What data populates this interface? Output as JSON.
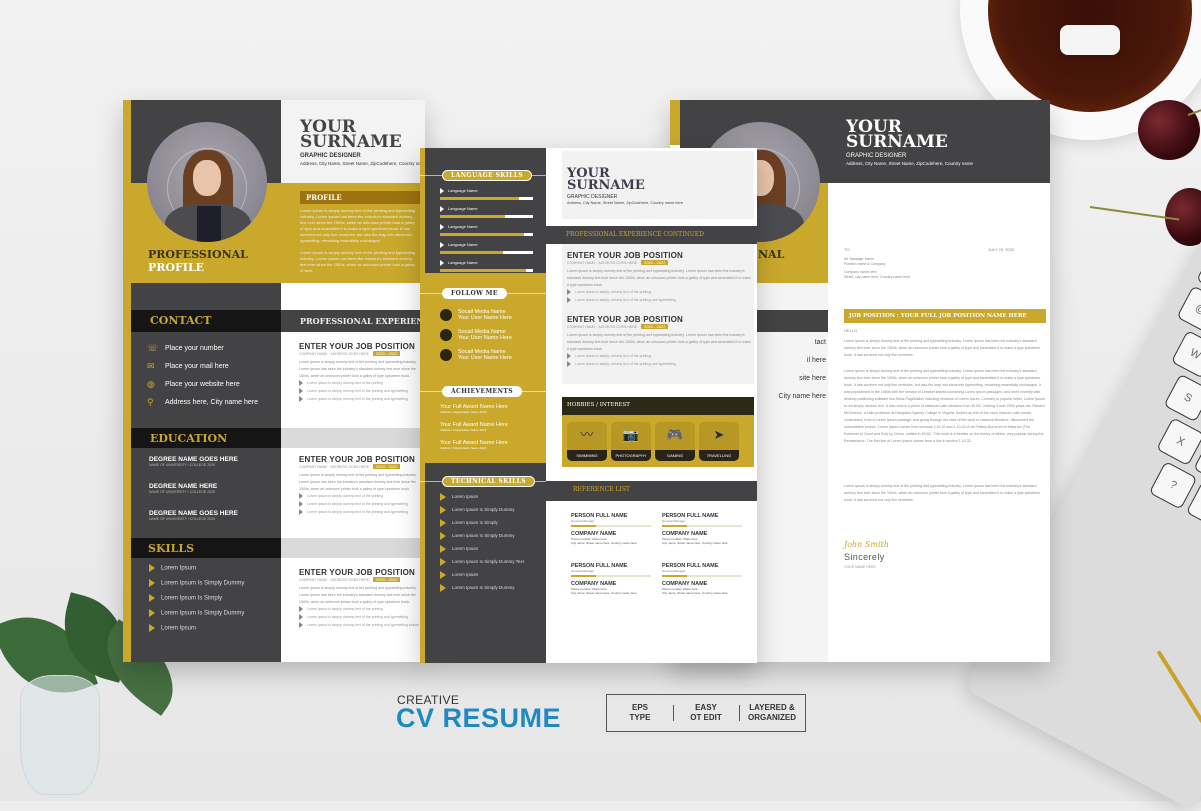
{
  "colors": {
    "gold": "#c9a82c",
    "dark": "#434345",
    "darker": "#151515",
    "accent_blue": "#1f8ac0"
  },
  "resume_front": {
    "name_line1": "YOUR",
    "name_line2": "SURNAME",
    "role": "GRAPHIC DESIGNER",
    "address": "Address, City Name, Street Name, ZipCodehere, Country name",
    "profile_title": "PROFILE",
    "profile_para1": "Lorem Ipsum is simply dummy text of the printing and typesetting industry. Lorem Ipsum has been the industry's standard dummy text ever since the 1500s, when an unknown printer took a galley of type and scrambled it to make a type specimen book. It has survived not only five centuries, but also the leap into electronic typesetting, remaining essentially unchanged.",
    "profile_para2": "Lorem Ipsum is simply dummy text of the printing and typesetting industry. Lorem Ipsum has been the industry's standard dummy text ever since the 1500s, when an unknown printer took a galley of type.",
    "professional_label1": "PROFESSIONAL",
    "professional_label2": "PROFILE",
    "contact_title": "CONTACT",
    "contact_items": [
      {
        "icon": "phone-icon",
        "text": "Place your number"
      },
      {
        "icon": "mail-icon",
        "text": "Place your mail here"
      },
      {
        "icon": "globe-icon",
        "text": "Place your website here"
      },
      {
        "icon": "location-icon",
        "text": "Address here, City name here"
      }
    ],
    "education_title": "EDUCATION",
    "education_items": [
      {
        "degree": "DEGREE NAME GOES HERE",
        "school": "NAME OF UNIVERSITY / COLLEGE  2020"
      },
      {
        "degree": "DEGREE NAME HERE",
        "school": "NAME OF UNIVERSITY / COLLEGE  2020"
      },
      {
        "degree": "DEGREE NAME GOES HERE",
        "school": "NAME OF UNIVERSITY / COLLEGE  2020"
      }
    ],
    "skills_title": "SKILLS",
    "skills": [
      "Lorem Ipsum",
      "Lorem Ipsum Is Simply Dummy",
      "Lorem Ipsum Is Simply",
      "Lorem Ipsum Is Simply Dummy",
      "Lorem Ipsum"
    ],
    "experience_title": "PROFESSIONAL EXPERIENCE",
    "jobs": [
      {
        "title": "ENTER YOUR JOB POSITION",
        "company": "COMPANY NAME · ADDRESS GOES HERE",
        "date": "2020 - 2022",
        "desc": "Lorem Ipsum is simply dummy text of the printing and typesetting industry. Lorem Ipsum has been the industry's standard dummy text ever since the 1500s, when an unknown printer took a galley of type specimen book.",
        "bullets": [
          "Lorem Ipsum is simply dummy text of the printing",
          "Lorem Ipsum is simply dummy text of the printing and typesetting",
          "Lorem Ipsum is simply dummy text of the printing and typesetting"
        ]
      },
      {
        "title": "ENTER YOUR JOB POSITION",
        "company": "COMPANY NAME · ADDRESS GOES HERE",
        "date": "2020 - 2022",
        "desc": "Lorem Ipsum is simply dummy text of the printing and typesetting industry. Lorem Ipsum has been the industry's standard dummy text ever since the 1500s, when an unknown printer took a galley of type specimen book.",
        "bullets": [
          "Lorem Ipsum is simply dummy text of the printing",
          "Lorem Ipsum is simply dummy text of the printing and typesetting",
          "Lorem Ipsum is simply dummy text of the printing and typesetting"
        ]
      },
      {
        "title": "ENTER YOUR JOB POSITION",
        "company": "COMPANY NAME · ADDRESS GOES HERE",
        "date": "2020 - 2022",
        "desc": "Lorem Ipsum is simply dummy text of the printing and typesetting industry. Lorem Ipsum has been the industry's standard dummy text ever since the 1500s, when an unknown printer took a galley of type specimen book.",
        "bullets": [
          "Lorem Ipsum is simply dummy text of the printing",
          "Lorem Ipsum is simply dummy text of the printing and typesetting",
          "Lorem Ipsum is simply dummy text of the printing and typesetting industry"
        ]
      }
    ]
  },
  "resume_back": {
    "language_title": "LANGUAGE SKILLS",
    "languages": [
      {
        "name": "Language Name",
        "level": 0.85
      },
      {
        "name": "Language Name",
        "level": 0.7
      },
      {
        "name": "Language Name",
        "level": 0.9
      },
      {
        "name": "Language Name",
        "level": 0.68
      },
      {
        "name": "Language Name",
        "level": 0.92
      }
    ],
    "follow_title": "FOLLOW ME",
    "social": [
      {
        "name": "Socail Media Name",
        "user": "Your User Name Here"
      },
      {
        "name": "Socail Media Name",
        "user": "Your User Name Here"
      },
      {
        "name": "Socail Media Name",
        "user": "Your User Name Here"
      }
    ],
    "achievements_title": "ACHIEVEMENTS",
    "achievements": [
      {
        "award": "Your Full Award Name Here",
        "detail": "Institute / Organization Name  2020"
      },
      {
        "award": "Your Full Award Name Here",
        "detail": "Institute / Organization Name  2020"
      },
      {
        "award": "Your Full Award Name Here",
        "detail": "Institute / Organization Name  2020"
      }
    ],
    "technical_title": "TECHNICAL SKILLS",
    "technical": [
      "Lorem Ipsum",
      "Lorem Ipsum Is Simply Dummy",
      "Lorem Ipsum Is Simply",
      "Lorem Ipsum Is Simply Dummy",
      "Lorem Ipsum",
      "Lorem Ipsum Is Simply Dummy Text",
      "Lorem Ipsum",
      "Lorem Ipsum Is Simply Dummy"
    ],
    "name_line1": "YOUR",
    "name_line2": "SURNAME",
    "role": "GRAPHIC DESIGNER",
    "address": "Address, City Name, Street Name, ZipCodehere, Country name here",
    "experience_cont_title": "PROFESSIONAL EXPERIENCE CONTINUED",
    "jobs": [
      {
        "title": "ENTER YOUR JOB POSITION",
        "company": "COMPANY NAME · ADDRESS GOES HERE",
        "date": "2020 - 2022",
        "desc": "Lorem Ipsum is simply dummy text of the printing and typesetting industry. Lorem Ipsum has been the industry's standard dummy text ever since the 1500s, when an unknown printer took a galley of type and scrambled it to make a type specimen book.",
        "bullets": [
          "Lorem Ipsum is simply dummy text of the printing",
          "Lorem Ipsum is simply dummy text of the printing and typesetting"
        ]
      },
      {
        "title": "ENTER YOUR JOB POSITION",
        "company": "COMPANY NAME · ADDRESS GOES HERE",
        "date": "2020 - 2022",
        "desc": "Lorem Ipsum is simply dummy text of the printing and typesetting industry. Lorem Ipsum has been the industry's standard dummy text ever since the 1500s, when an unknown printer took a galley of type and scrambled it to make a type specimen book.",
        "bullets": [
          "Lorem Ipsum is simply dummy text of the printing",
          "Lorem Ipsum is simply dummy text of the printing and typesetting"
        ]
      }
    ],
    "hobbies_title": "HOBBIES / INTEREST",
    "hobbies": [
      {
        "icon": "swimming-icon",
        "label": "SWIMMING"
      },
      {
        "icon": "camera-icon",
        "label": "PHOTOGRAPHY"
      },
      {
        "icon": "gamepad-icon",
        "label": "GAMING"
      },
      {
        "icon": "plane-icon",
        "label": "TRAVELLING"
      }
    ],
    "reference_title": "REFERENCE LIST",
    "references": [
      {
        "person": "PERSON FULL NAME",
        "role": "General Manager",
        "company": "COMPANY NAME",
        "phone": "Phone number: Place here",
        "address": "City name, Street name here, Country name here"
      },
      {
        "person": "PERSON FULL NAME",
        "role": "General Manager",
        "company": "COMPANY NAME",
        "phone": "Phone number: Place here",
        "address": "City name, Street name here, Country name here"
      },
      {
        "person": "PERSON FULL NAME",
        "role": "General Manager",
        "company": "COMPANY NAME",
        "phone": "Phone number: Place here",
        "address": "City name, Street name here, Country name here"
      },
      {
        "person": "PERSON FULL NAME",
        "role": "General Manager",
        "company": "COMPANY NAME",
        "phone": "Phone number: Place here",
        "address": "City name, Street name here, Country name here"
      }
    ]
  },
  "cover_letter": {
    "name_line1": "YOUR",
    "name_line2": "SURNAME",
    "role": "GRAPHIC DESIGNER",
    "address": "Address, City Name, Street Name, ZipCodehere, Country name",
    "professional_label": "NAL",
    "sidebar_fragments": [
      "tact",
      "il here",
      "site here",
      "City name here"
    ],
    "to_label": "TO",
    "date": "JULY 25, 2025",
    "recipient_lines": [
      "Mr. Manager Name",
      "Position name & Company",
      "Company name here",
      "Street, city name here, Country name here"
    ],
    "job_banner": "JOB POSITION : YOUR FULL JOB POSITION NAME HERE",
    "greeting": "HELLO,",
    "paragraphs": [
      "Lorem Ipsum is simply dummy text of the printing and typesetting industry. Lorem Ipsum has been the industry's standard dummy text ever since the 1500s, when an unknown printer took a galley of type and scrambled it to make a type specimen book. It has survived not only five centuries.",
      "Lorem Ipsum is simply dummy text of the printing and typesetting industry. Lorem Ipsum has been the industry's standard dummy text ever since the 1500s, when an unknown printer took a galley of type and scrambled it to make a type specimen book. It has survived not only five centuries, but also the leap into electronic typesetting, remaining essentially unchanged. It was popularised in the 1960s with the release of Letraset sheets containing Lorem Ipsum passages, and more recently with desktop publishing software like Aldus PageMaker including versions of Lorem Ipsum. Contrary to popular belief, Lorem Ipsum is not simply random text. It has roots in a piece of classical Latin literature from 45 BC, making it over 2000 years old. Richard McClintock, a Latin professor at Hampden-Sydney College in Virginia, looked up one of the more obscure Latin words, consectetur, from a Lorem Ipsum passage, and going through the cites of the word in classical literature, discovered the undoubtable source. Lorem Ipsum comes from sections 1.10.32 and 1.10.33 of de Finibus Bonorum et Malorum (The Extremes of Good and Evil) by Cicero, written in 45 BC. This book is a treatise on the theory of ethics, very popular during the Renaissance. The first line of Lorem Ipsum comes from a line in section 1.10.32.",
      "Lorem Ipsum is simply dummy text of the printing and typesetting industry. Lorem Ipsum has been the industry's standard dummy text ever since the 1500s, when an unknown printer took a galley of type and scrambled it to make a type specimen book. It has survived not only five centuries."
    ],
    "signature": "John Smith",
    "closing": "Sincerely",
    "closing_name": "YOUR NAME HERE"
  },
  "branding": {
    "kicker": "CREATIVE",
    "title": "CV RESUME",
    "features": [
      {
        "line1": "EPS",
        "line2": "TYPE"
      },
      {
        "line1": "EASY",
        "line2": "OT EDIT"
      },
      {
        "line1": "LAYERED &",
        "line2": "ORGANIZED"
      }
    ]
  }
}
